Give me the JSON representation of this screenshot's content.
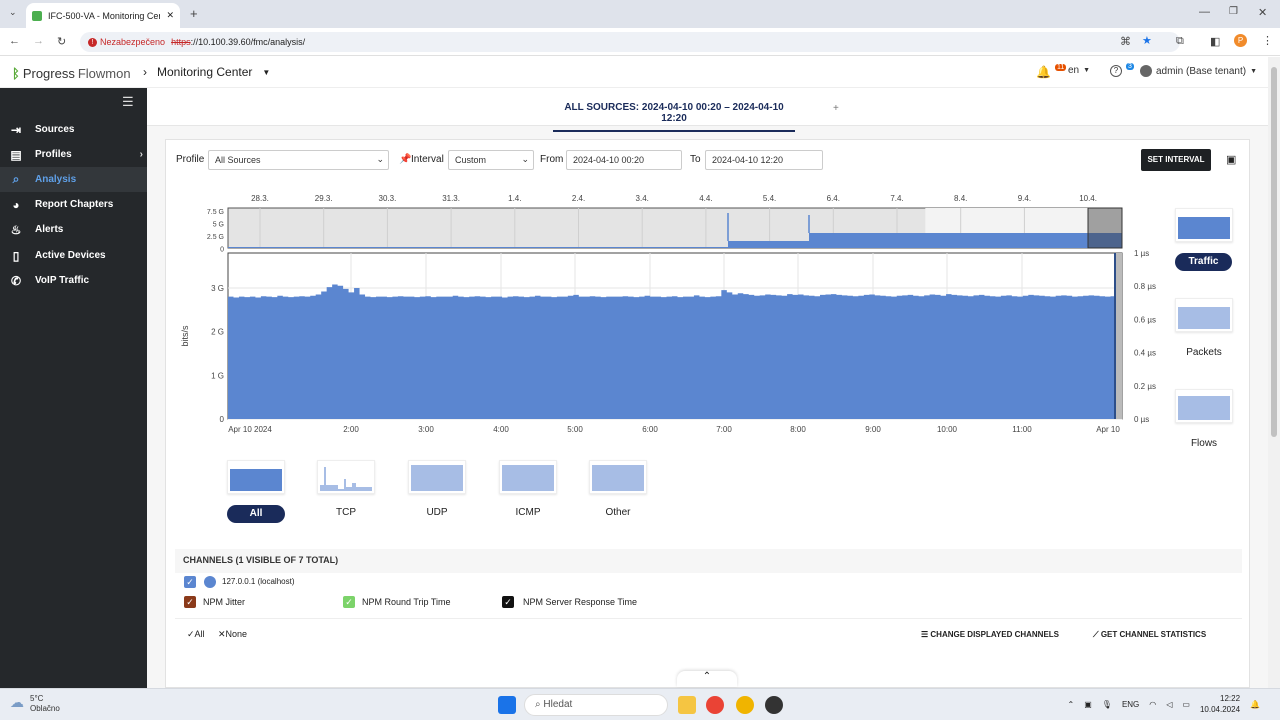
{
  "browser": {
    "tab_title": "IFC-500-VA - Monitoring Cente",
    "security_label": "Nezabezpečeno",
    "url_proto": "https",
    "url_rest": "://10.100.39.60/fmc/analysis/"
  },
  "header": {
    "brand_a": "Progress",
    "brand_b": "Flowmon",
    "section": "Monitoring Center",
    "alerts_count": "11",
    "lang": "en",
    "help_count": "3",
    "user": "admin (Base tenant)"
  },
  "sidebar": {
    "items": [
      {
        "label": "Sources",
        "icon": "sources-icon"
      },
      {
        "label": "Profiles",
        "icon": "profiles-icon"
      },
      {
        "label": "Analysis",
        "icon": "search-icon"
      },
      {
        "label": "Report Chapters",
        "icon": "pie-chart-icon"
      },
      {
        "label": "Alerts",
        "icon": "flame-icon"
      },
      {
        "label": "Active Devices",
        "icon": "device-icon"
      },
      {
        "label": "VoIP Traffic",
        "icon": "voip-icon"
      }
    ]
  },
  "main": {
    "tab_label": "ALL SOURCES: 2024-04-10 00:20 – 2024-04-10 12:20",
    "add_tab": "+",
    "filters": {
      "profile_label": "Profile",
      "profile_value": "All Sources",
      "interval_label": "Interval",
      "interval_value": "Custom",
      "from_label": "From",
      "from_value": "2024-04-10 00:20",
      "to_label": "To",
      "to_value": "2024-04-10 12:20",
      "set_interval": "SET INTERVAL"
    },
    "overview": {
      "dates": [
        "28.3.",
        "29.3.",
        "30.3.",
        "31.3.",
        "1.4.",
        "2.4.",
        "3.4.",
        "4.4.",
        "5.4.",
        "6.4.",
        "7.4.",
        "8.4.",
        "9.4.",
        "10.4."
      ],
      "y_ticks": [
        "7.5 G",
        "5 G",
        "2.5 G",
        "0"
      ]
    },
    "chart_data": {
      "type": "area",
      "ylabel": "bits/s",
      "y_ticks": [
        "0",
        "1 G",
        "2 G",
        "3 G"
      ],
      "ylim": [
        0,
        3.8
      ],
      "y2_ticks": [
        "0 µs",
        "0.2 µs",
        "0.4 µs",
        "0.6 µs",
        "0.8 µs",
        "1 µs"
      ],
      "x_ticks": [
        "Apr 10 2024",
        "2:00",
        "3:00",
        "4:00",
        "5:00",
        "6:00",
        "7:00",
        "8:00",
        "9:00",
        "10:00",
        "11:00",
        "Apr 10"
      ],
      "series": [
        {
          "name": "127.0.0.1 (localhost)",
          "color": "#5b86d0",
          "values": [
            2.8,
            2.78,
            2.8,
            2.79,
            2.8,
            2.78,
            2.81,
            2.8,
            2.79,
            2.82,
            2.8,
            2.79,
            2.8,
            2.81,
            2.8,
            2.82,
            2.85,
            2.92,
            3.02,
            3.08,
            3.05,
            2.98,
            2.9,
            3.0,
            2.85,
            2.8,
            2.79,
            2.8,
            2.8,
            2.79,
            2.8,
            2.81,
            2.8,
            2.8,
            2.79,
            2.8,
            2.81,
            2.79,
            2.8,
            2.8,
            2.8,
            2.82,
            2.8,
            2.79,
            2.8,
            2.81,
            2.8,
            2.79,
            2.8,
            2.8,
            2.78,
            2.8,
            2.81,
            2.8,
            2.79,
            2.8,
            2.82,
            2.8,
            2.8,
            2.79,
            2.8,
            2.8,
            2.82,
            2.84,
            2.8,
            2.8,
            2.81,
            2.8,
            2.79,
            2.8,
            2.8,
            2.8,
            2.81,
            2.8,
            2.79,
            2.8,
            2.82,
            2.8,
            2.8,
            2.79,
            2.8,
            2.81,
            2.79,
            2.8,
            2.8,
            2.83,
            2.8,
            2.79,
            2.8,
            2.81,
            2.95,
            2.9,
            2.85,
            2.88,
            2.86,
            2.84,
            2.82,
            2.83,
            2.85,
            2.84,
            2.83,
            2.82,
            2.86,
            2.84,
            2.85,
            2.83,
            2.82,
            2.81,
            2.84,
            2.85,
            2.86,
            2.84,
            2.83,
            2.82,
            2.81,
            2.82,
            2.84,
            2.85,
            2.83,
            2.82,
            2.81,
            2.8,
            2.82,
            2.83,
            2.84,
            2.82,
            2.81,
            2.83,
            2.85,
            2.84,
            2.82,
            2.86,
            2.84,
            2.83,
            2.82,
            2.81,
            2.83,
            2.84,
            2.82,
            2.81,
            2.8,
            2.82,
            2.83,
            2.81,
            2.8,
            2.82,
            2.84,
            2.83,
            2.82,
            2.81,
            2.8,
            2.82,
            2.83,
            2.82,
            2.8,
            2.81,
            2.82,
            2.83,
            2.82,
            2.81,
            2.8,
            2.81
          ]
        }
      ]
    },
    "right_panel": {
      "traffic": "Traffic",
      "packets": "Packets",
      "flows": "Flows"
    },
    "protocols": [
      "All",
      "TCP",
      "UDP",
      "ICMP",
      "Other"
    ],
    "channels": {
      "header": "CHANNELS (1 VISIBLE OF 7 TOTAL)",
      "main_channel": "127.0.0.1 (localhost)",
      "npm": [
        {
          "label": "NPM Jitter",
          "color": "#8b3a1a"
        },
        {
          "label": "NPM Round Trip Time",
          "color": "#7cd36a"
        },
        {
          "label": "NPM Server Response Time",
          "color": "#111111"
        }
      ],
      "select_all": "All",
      "select_none": "None",
      "change_channels": "CHANGE DISPLAYED CHANNELS",
      "get_stats": "GET CHANNEL STATISTICS"
    }
  },
  "taskbar": {
    "temp": "5°C",
    "weather": "Oblačno",
    "search": "Hledat",
    "lang": "ENG",
    "time": "12:22",
    "date": "10.04.2024"
  }
}
